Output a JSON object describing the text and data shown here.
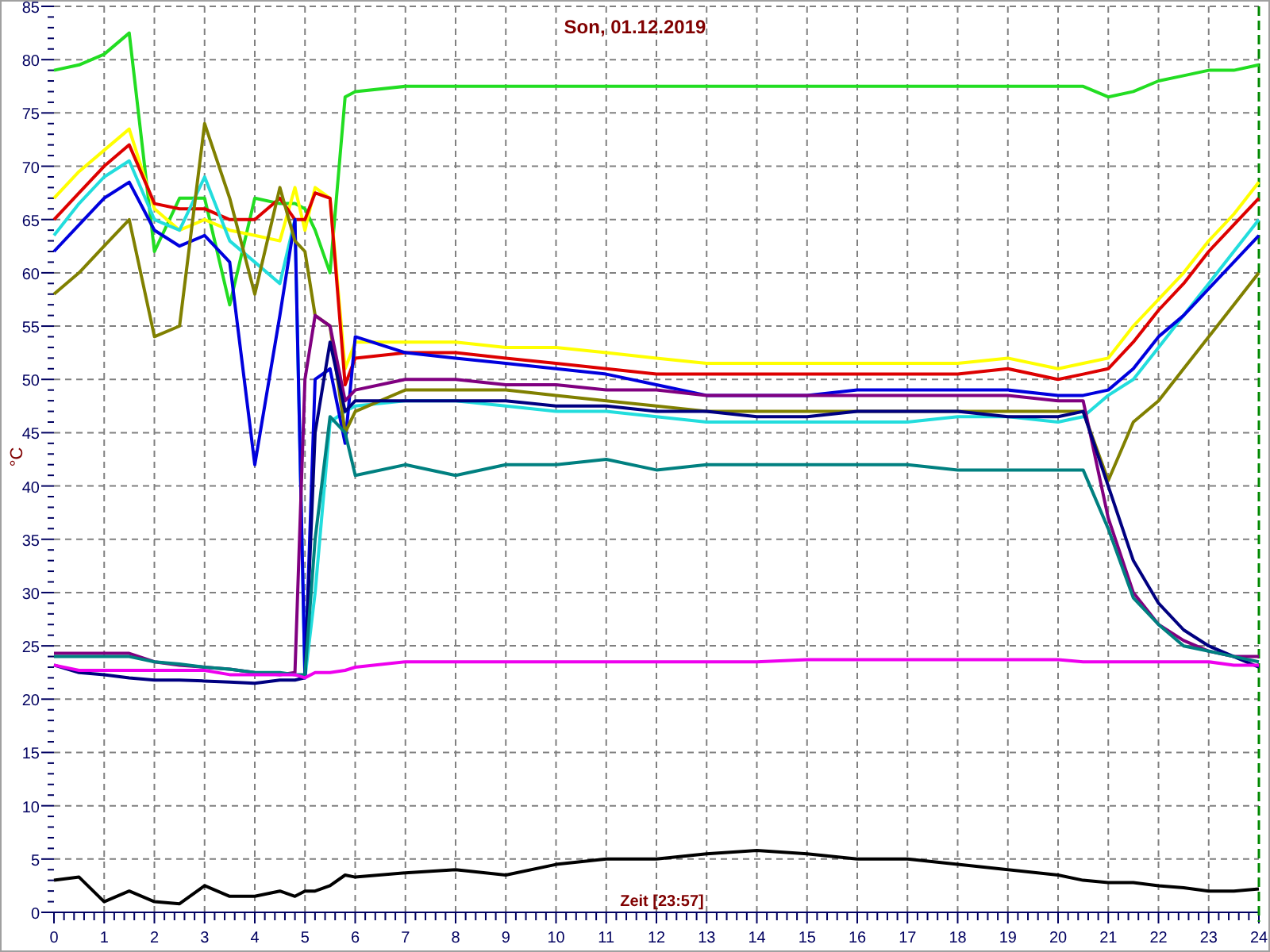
{
  "chart_data": {
    "type": "line",
    "title": "Son, 01.12.2019",
    "xlabel": "Zeit [23:57]",
    "ylabel": "°C",
    "xlim": [
      0,
      24
    ],
    "ylim": [
      0,
      85
    ],
    "xticks": [
      0,
      1,
      2,
      3,
      4,
      5,
      6,
      7,
      8,
      9,
      10,
      11,
      12,
      13,
      14,
      15,
      16,
      17,
      18,
      19,
      20,
      21,
      22,
      23,
      24
    ],
    "yticks": [
      0,
      5,
      10,
      15,
      20,
      25,
      30,
      35,
      40,
      45,
      50,
      55,
      60,
      65,
      70,
      75,
      80,
      85
    ],
    "x": [
      0,
      0.5,
      1,
      1.5,
      2,
      2.5,
      3,
      3.5,
      4,
      4.5,
      4.8,
      5,
      5.2,
      5.5,
      5.8,
      6,
      7,
      8,
      9,
      10,
      11,
      12,
      13,
      14,
      15,
      16,
      17,
      18,
      19,
      20,
      20.5,
      21,
      21.5,
      22,
      22.5,
      23,
      23.5,
      24
    ],
    "series": [
      {
        "color": "#22dd22",
        "values": [
          79,
          79.5,
          80.5,
          82.5,
          62,
          67,
          67,
          57,
          67,
          66.5,
          66.5,
          66,
          64,
          60,
          76.5,
          77,
          77.5,
          77.5,
          77.5,
          77.5,
          77.5,
          77.5,
          77.5,
          77.5,
          77.5,
          77.5,
          77.5,
          77.5,
          77.5,
          77.5,
          77.5,
          76.5,
          77,
          78,
          78.5,
          79,
          79,
          79.5
        ]
      },
      {
        "color": "#ffff00",
        "values": [
          67,
          69.5,
          71.5,
          73.5,
          66,
          64,
          65,
          64,
          63.5,
          63,
          68,
          64,
          68,
          67,
          51,
          53.5,
          53.5,
          53.5,
          53,
          53,
          52.5,
          52,
          51.5,
          51.5,
          51.5,
          51.5,
          51.5,
          51.5,
          52,
          51,
          51.5,
          52,
          55,
          57.5,
          60,
          63,
          65.5,
          68.5
        ]
      },
      {
        "color": "#dd0000",
        "values": [
          65,
          67.5,
          70,
          72,
          66.5,
          66,
          66,
          65,
          65,
          67,
          65,
          65,
          67.5,
          67,
          49.5,
          52,
          52.5,
          52.5,
          52,
          51.5,
          51,
          50.5,
          50.5,
          50.5,
          50.5,
          50.5,
          50.5,
          50.5,
          51,
          50,
          50.5,
          51,
          53.5,
          56.5,
          59,
          62,
          64.5,
          67
        ]
      },
      {
        "color": "#22dddd",
        "values": [
          63.5,
          66.5,
          69,
          70.5,
          65,
          64,
          69,
          63,
          61,
          59,
          65,
          22,
          30,
          46,
          47,
          47.5,
          48,
          48,
          47.5,
          47,
          47,
          46.5,
          46,
          46,
          46,
          46,
          46,
          46.5,
          46.5,
          46,
          46.5,
          48.5,
          50,
          53,
          56,
          59,
          62,
          65
        ]
      },
      {
        "color": "#0000dd",
        "values": [
          62,
          64.5,
          67,
          68.5,
          64,
          62.5,
          63.5,
          61,
          42,
          56,
          65,
          22,
          50,
          51,
          44,
          54,
          52.5,
          52,
          51.5,
          51,
          50.5,
          49.5,
          48.5,
          48.5,
          48.5,
          49,
          49,
          49,
          49,
          48.5,
          48.5,
          49,
          51,
          54,
          56,
          58.5,
          61,
          63.5
        ]
      },
      {
        "color": "#808000",
        "values": [
          58,
          60,
          62.5,
          65,
          54,
          55,
          74,
          67,
          58,
          68,
          63,
          62,
          56,
          55,
          45,
          47,
          49,
          49,
          49,
          48.5,
          48,
          47.5,
          47,
          47,
          47,
          47,
          47,
          47,
          47,
          47,
          47,
          40.5,
          46,
          48,
          51,
          54,
          57,
          60
        ]
      },
      {
        "color": "#800080",
        "values": [
          24.3,
          24.3,
          24.3,
          24.3,
          23.5,
          23.2,
          23,
          22.8,
          22.5,
          22.3,
          22.5,
          50,
          56,
          55,
          48,
          49,
          50,
          50,
          49.5,
          49.5,
          49,
          49,
          48.5,
          48.5,
          48.5,
          48.5,
          48.5,
          48.5,
          48.5,
          48,
          48,
          37,
          30,
          27,
          25.5,
          24.5,
          24,
          24
        ]
      },
      {
        "color": "#000080",
        "values": [
          23.2,
          22.5,
          22.3,
          22,
          21.8,
          21.8,
          21.7,
          21.6,
          21.5,
          21.8,
          21.8,
          22,
          45,
          53.5,
          47,
          48,
          48,
          48,
          48,
          47.5,
          47.5,
          47,
          47,
          46.5,
          46.5,
          47,
          47,
          47,
          46.5,
          46.5,
          47,
          40,
          33,
          29,
          26.5,
          25,
          24,
          23
        ]
      },
      {
        "color": "#008080",
        "values": [
          24,
          24,
          24,
          24,
          23.5,
          23.3,
          23,
          22.8,
          22.5,
          22.5,
          22.3,
          22.3,
          35,
          46.5,
          45,
          41,
          42,
          41,
          42,
          42,
          42.5,
          41.5,
          42,
          42,
          42,
          42,
          42,
          41.5,
          41.5,
          41.5,
          41.5,
          36,
          29.5,
          27,
          25,
          24.5,
          24,
          23.5
        ]
      },
      {
        "color": "#ee00ee",
        "values": [
          23.2,
          22.7,
          22.7,
          22.7,
          22.7,
          22.7,
          22.7,
          22.3,
          22.3,
          22.3,
          22.3,
          22,
          22.5,
          22.5,
          22.7,
          23,
          23.5,
          23.5,
          23.5,
          23.5,
          23.5,
          23.5,
          23.5,
          23.5,
          23.7,
          23.7,
          23.7,
          23.7,
          23.7,
          23.7,
          23.5,
          23.5,
          23.5,
          23.5,
          23.5,
          23.5,
          23.2,
          23.2
        ]
      },
      {
        "color": "#000000",
        "values": [
          3,
          3.3,
          1,
          2,
          1,
          0.8,
          2.5,
          1.5,
          1.5,
          2,
          1.5,
          2,
          2,
          2.5,
          3.5,
          3.3,
          3.7,
          4,
          3.5,
          4.5,
          5,
          5,
          5.5,
          5.8,
          5.5,
          5,
          5,
          4.5,
          4,
          3.5,
          3,
          2.8,
          2.8,
          2.5,
          2.3,
          2,
          2,
          2.2
        ]
      }
    ],
    "grid": true
  }
}
